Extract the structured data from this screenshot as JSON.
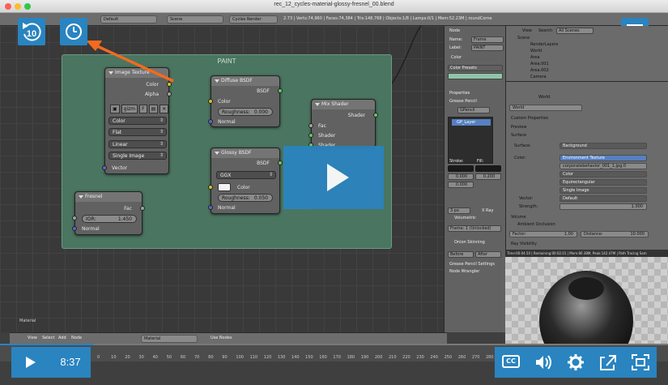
{
  "window": {
    "title": "rec_12_cycles-material-glossy-fresnel_00.blend"
  },
  "info_header": {
    "layout": "Default",
    "scene": "Scene",
    "engine": "Cycles Render",
    "stats": "2.73 | Verts:74,960 | Faces:74,384 | Tris:148,768 | Objects:1/8 | Lamps:0/1 | Mem:52.23M | roundCorne"
  },
  "node_editor": {
    "frame_label": "PAINT",
    "image_texture": {
      "title": "Image Texture",
      "out_color": "Color",
      "out_alpha": "Alpha",
      "image_name": "gizm",
      "image_flag": "F",
      "color_space": "Color",
      "projection": "Flat",
      "interpolation": "Linear",
      "source": "Single Image",
      "in_vector": "Vector"
    },
    "diffuse": {
      "title": "Diffuse BSDF",
      "out": "BSDF",
      "in_color": "Color",
      "roughness_label": "Roughness:",
      "roughness_value": "0.000",
      "in_normal": "Normal"
    },
    "glossy": {
      "title": "Glossy BSDF",
      "out": "BSDF",
      "distribution": "GGX",
      "in_color": "Color",
      "roughness_label": "Roughness:",
      "roughness_value": "0.050",
      "in_normal": "Normal"
    },
    "mix": {
      "title": "Mix Shader",
      "out": "Shader",
      "in_fac": "Fac",
      "in_shader1": "Shader",
      "in_shader2": "Shader"
    },
    "fresnel": {
      "title": "Fresnel",
      "out_fac": "Fac",
      "ior_label": "IOR:",
      "ior_value": "1.450",
      "in_normal": "Normal"
    },
    "material_label": "Material"
  },
  "ne_header": {
    "view": "View",
    "select": "Select",
    "add": "Add",
    "node": "Node",
    "material": "Material",
    "use_nodes": "Use Nodes"
  },
  "timeline": {
    "menu_view": "View",
    "menu_marker": "Marker",
    "menu_frame": "Frame",
    "menu_playback": "Playback",
    "start_label": "Start:",
    "start_value": "1",
    "end_label": "End:",
    "end_value": "250",
    "current_frame": "1",
    "sync": "No Sync",
    "ruler": [
      "0",
      "10",
      "20",
      "30",
      "40",
      "50",
      "60",
      "70",
      "80",
      "90",
      "100",
      "110",
      "120",
      "130",
      "140",
      "150",
      "160",
      "170",
      "180",
      "190",
      "200",
      "210",
      "220",
      "230",
      "240",
      "250",
      "260",
      "270",
      "280"
    ]
  },
  "node_panel": {
    "section_node": "Node",
    "name_label": "Name:",
    "name_value": "Frame",
    "label_label": "Label:",
    "label_value": "PAINT",
    "section_color": "Color",
    "color_presets": "Color Presets",
    "section_properties": "Properties",
    "section_grease": "Grease Pencil",
    "gp_name": "GPencil",
    "gp_layer": "GP_Layer",
    "stroke": "Stroke:",
    "fill": "Fill:",
    "val_a": "0.000",
    "val_b": "0.200",
    "px": "3 px",
    "xray": "X Ray",
    "volumetric": "Volumetric",
    "frame_info": "Frame: 1 (Unlocked)",
    "onion": "Onion Skinning",
    "before": "Before",
    "after": "After",
    "gp_settings": "Grease Pencil Settings",
    "node_wrangler": "Node Wrangler"
  },
  "outliner": {
    "view": "View",
    "search": "Search",
    "all_scenes": "All Scenes",
    "items": [
      "Scene",
      "RenderLayers",
      "World",
      "Area",
      "Area.001",
      "Area.002",
      "Camera"
    ]
  },
  "props": {
    "world_label": "World",
    "world_name": "World",
    "custom_props": "Custom Properties",
    "preview": "Preview",
    "surface_section": "Surface",
    "surface_label": "Surface:",
    "surface_value": "Background",
    "color_label": "Color:",
    "env_texture": "Environment Texture",
    "env_image": "corporatebehavior_001_1.jpg.0",
    "env_color": "Color",
    "env_proj": "Equirectangular",
    "env_source": "Single Image",
    "vector_label": "Vector:",
    "vector_value": "Default",
    "strength_label": "Strength:",
    "strength_value": "1.000",
    "volume_section": "Volume",
    "ao_section": "Ambient Occlusion",
    "factor_label": "Factor:",
    "factor_value": "1.00",
    "distance_label": "Distance:",
    "distance_value": "10.000",
    "ray_vis": "Ray Visibility"
  },
  "render": {
    "stats": "Time:00:04.50 | Remaining:00:02.01 | Mem:80.38M, Peak:142.47M | Path Tracing Sam"
  },
  "player": {
    "time": "8:37",
    "cc": "CC",
    "progress": 0.14,
    "accent": "#2a84c0"
  },
  "overlay": {
    "rewind_seconds": "10"
  },
  "icons": {
    "rewind": "rewind-10-icon",
    "clock": "clock-icon",
    "laptop": "laptop-icon",
    "play": "play-icon",
    "volume": "volume-icon",
    "settings": "gear-icon",
    "share": "share-icon",
    "fullscreen": "fullscreen-icon"
  }
}
